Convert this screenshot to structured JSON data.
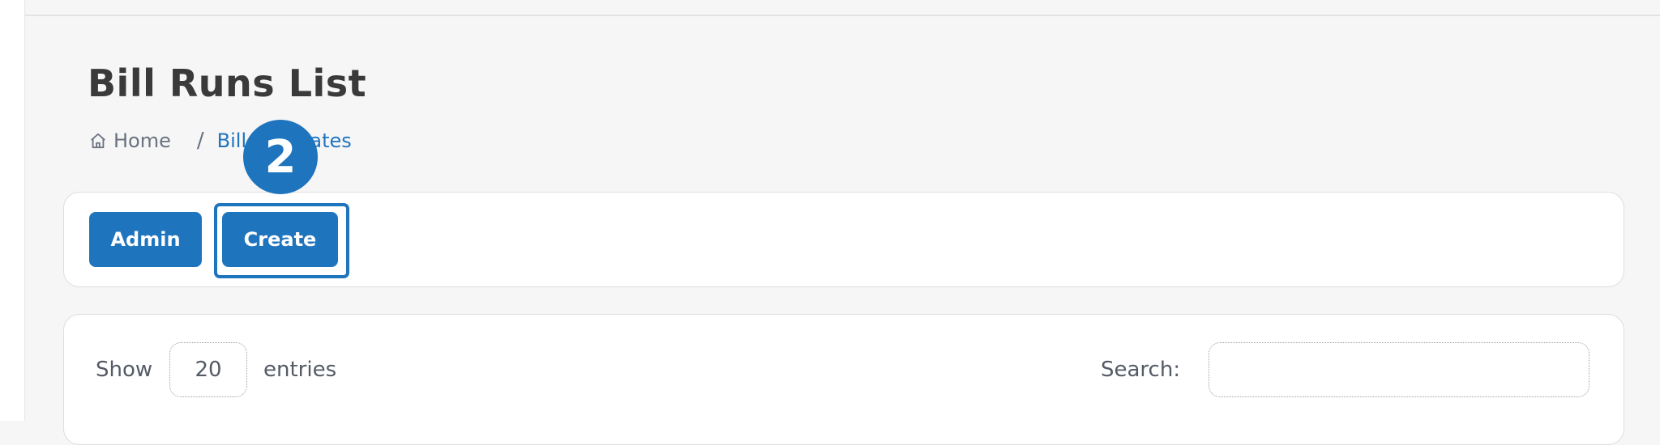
{
  "page": {
    "title": "Bill Runs List"
  },
  "breadcrumb": {
    "home_label": "Home",
    "separator": "/",
    "current_label": "Bill Templates"
  },
  "annotation": {
    "step_number": "2"
  },
  "actions": {
    "admin_label": "Admin",
    "create_label": "Create"
  },
  "table_controls": {
    "show_label": "Show",
    "page_size": "20",
    "entries_label": "entries",
    "search_label": "Search:",
    "search_value": ""
  },
  "colors": {
    "accent": "#1f74be",
    "background": "#f6f6f6",
    "card": "#ffffff"
  },
  "icons": {
    "home": "home-icon"
  }
}
